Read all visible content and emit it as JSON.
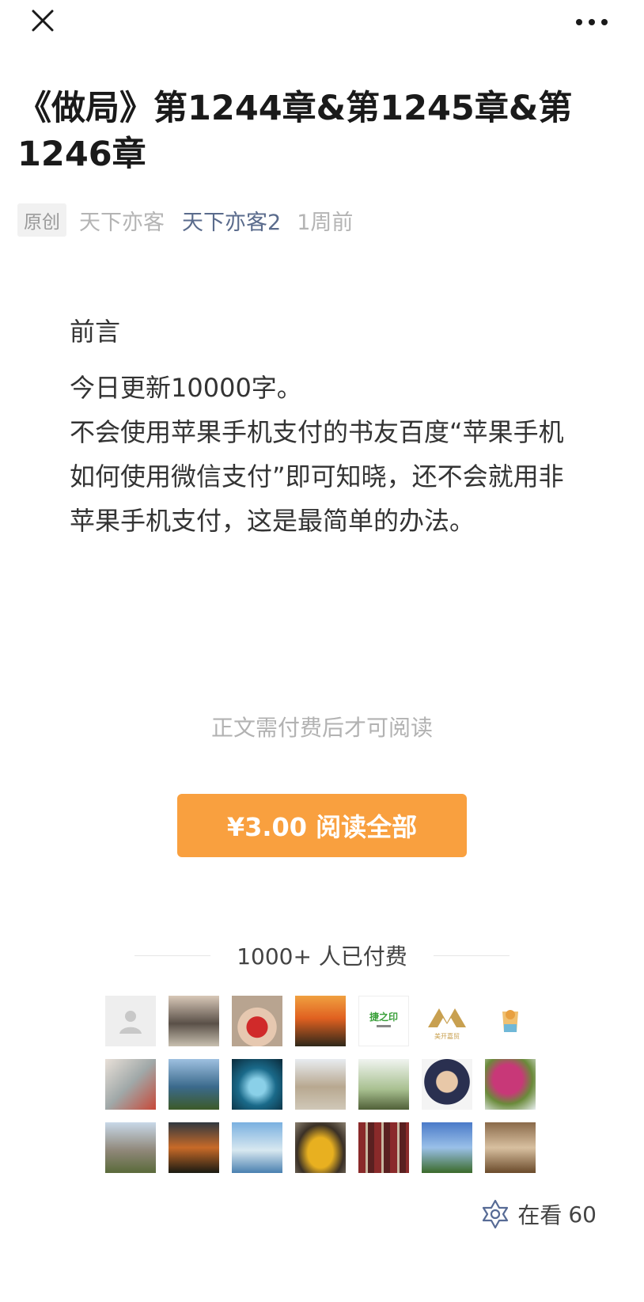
{
  "article": {
    "title": "《做局》第1244章&第1245章&第1246章",
    "original_tag": "原创",
    "author": "天下亦客",
    "account": "天下亦客2",
    "time": "1周前"
  },
  "preface": {
    "heading": "前言",
    "paragraphs": [
      "今日更新10000字。",
      "不会使用苹果手机支付的书友百度“苹果手机如何使用微信支付”即可知晓，还不会就用非苹果手机支付，这是最简单的办法。"
    ]
  },
  "paywall": {
    "note": "正文需付费后才可阅读",
    "button_label": "¥3.00 阅读全部",
    "button_color": "#f9a03f",
    "payers_label": "1000+ 人已付费"
  },
  "payer_avatars": [
    {
      "name": "default-avatar-icon"
    },
    {
      "name": "man-portrait"
    },
    {
      "name": "child-portrait"
    },
    {
      "name": "sunset-plant"
    },
    {
      "name": "logo-green",
      "text": "捷之印"
    },
    {
      "name": "logo-gold",
      "text": "美开嘉贸"
    },
    {
      "name": "cartoon-cup"
    },
    {
      "name": "lamp-room"
    },
    {
      "name": "sea-cliff"
    },
    {
      "name": "blue-circle"
    },
    {
      "name": "mountain-flag"
    },
    {
      "name": "man-outdoor"
    },
    {
      "name": "man-glasses"
    },
    {
      "name": "pink-tree"
    },
    {
      "name": "statue"
    },
    {
      "name": "sunset-field"
    },
    {
      "name": "sailboat"
    },
    {
      "name": "sports-car"
    },
    {
      "name": "bookshelf"
    },
    {
      "name": "sky-tree"
    },
    {
      "name": "horses"
    }
  ],
  "footer": {
    "watching_label": "在看",
    "watching_count": "60"
  }
}
